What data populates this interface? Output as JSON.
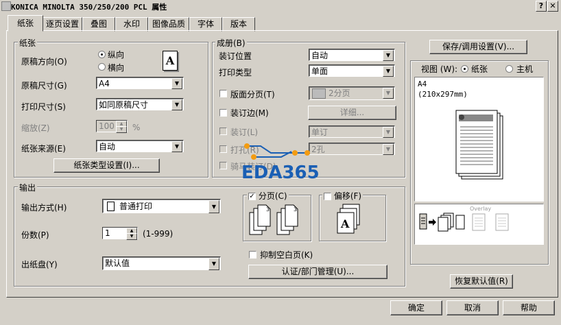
{
  "window": {
    "title": "KONICA MINOLTA 350/250/200 PCL 属性",
    "help_btn": "?",
    "close_btn": "✕"
  },
  "tabs": [
    {
      "label": "纸张"
    },
    {
      "label": "逐页设置"
    },
    {
      "label": "叠图"
    },
    {
      "label": "水印"
    },
    {
      "label": "图像品质"
    },
    {
      "label": "字体"
    },
    {
      "label": "版本"
    }
  ],
  "paper": {
    "group_title": "纸张",
    "orientation_label": "原稿方向(O)",
    "portrait": "纵向",
    "landscape": "横向",
    "orientation_icon": "A",
    "original_size_label": "原稿尺寸(G)",
    "original_size": "A4",
    "print_size_label": "打印尺寸(S)",
    "print_size": "如同原稿尺寸",
    "zoom_label": "缩放(Z)",
    "zoom_value": "100",
    "zoom_unit": "%",
    "source_label": "纸张来源(E)",
    "source": "自动",
    "type_button": "纸张类型设置(I)..."
  },
  "finishing": {
    "group_title": "成册(B)",
    "binding_pos_label": "装订位置",
    "binding_pos": "自动",
    "print_type_label": "打印类型",
    "print_type": "单面",
    "layout_label": "版面分页(T)",
    "layout_value": "2分页",
    "margin_label": "装订边(M)",
    "detail_button": "详细...",
    "staple_label": "装订(L)",
    "staple_value": "单订",
    "punch_label": "打孔(R)",
    "punch_value": "2孔",
    "saddle_label": "骑马装订(D)"
  },
  "output": {
    "group_title": "输出",
    "method_label": "输出方式(H)",
    "method": "普通打印",
    "copies_label": "份数(P)",
    "copies": "1",
    "copies_range": "(1-999)",
    "tray_label": "出纸盘(Y)",
    "tray": "默认值",
    "collate_label": "分页(C)",
    "offset_label": "偏移(F)",
    "suppress_blank_label": "抑制空白页(K)",
    "auth_button": "认证/部门管理(U)..."
  },
  "right": {
    "save_button": "保存/调用设置(V)...",
    "view_label": "视图 (W):",
    "view_paper": "纸张",
    "view_machine": "主机",
    "preview_size": "A4",
    "preview_dims": "(210x297mm)",
    "overlay_text": "Overlay",
    "restore_button": "恢复默认值(R)"
  },
  "watermark": "EDA365",
  "footer": {
    "ok": "确定",
    "cancel": "取消",
    "help": "帮助"
  }
}
